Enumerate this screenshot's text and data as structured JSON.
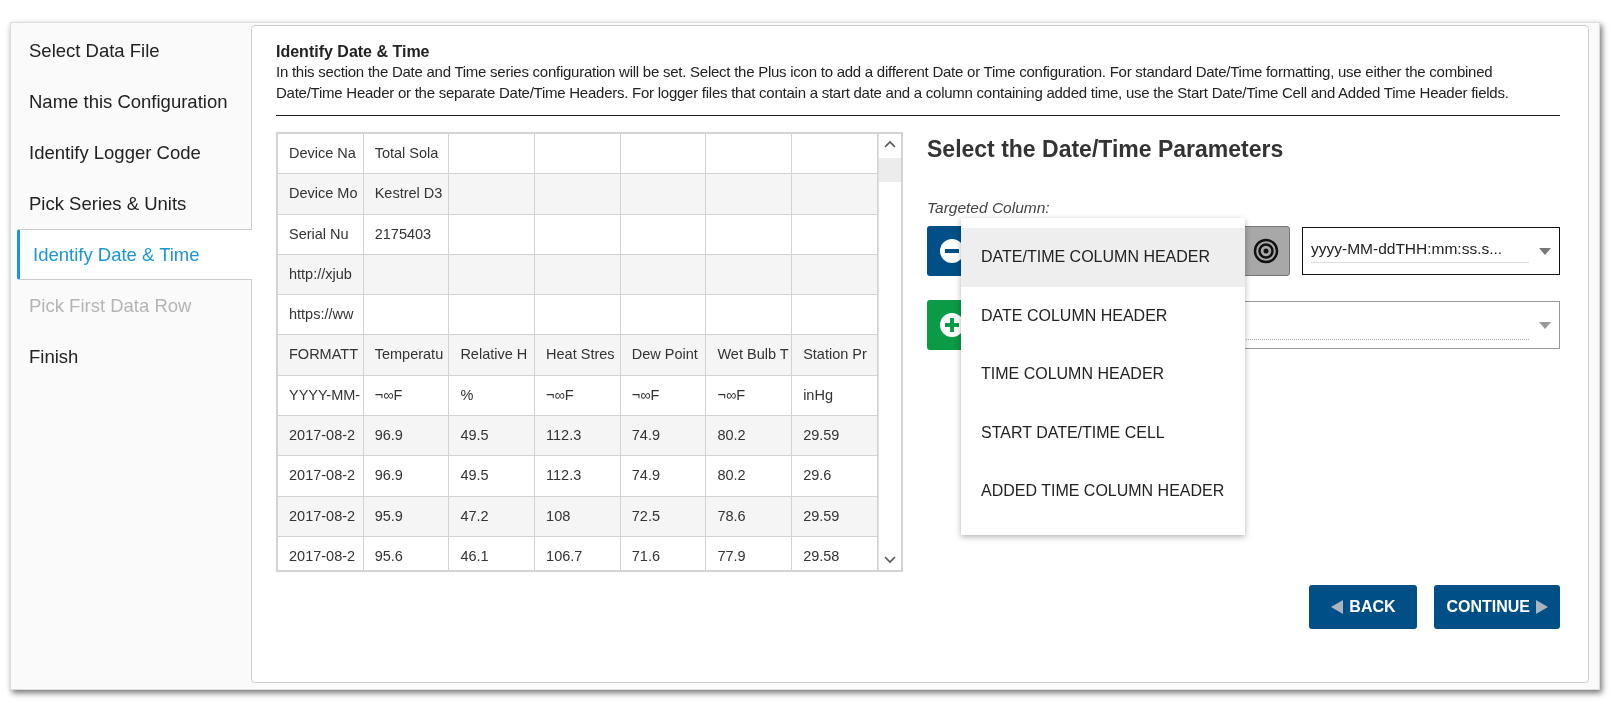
{
  "sidebar": {
    "items": [
      {
        "label": "Select Data File",
        "selected": false,
        "disabled": false
      },
      {
        "label": "Name this Configuration",
        "selected": false,
        "disabled": false
      },
      {
        "label": "Identify Logger Code",
        "selected": false,
        "disabled": false
      },
      {
        "label": "Pick Series & Units",
        "selected": false,
        "disabled": false
      },
      {
        "label": "Identify Date & Time",
        "selected": true,
        "disabled": false
      },
      {
        "label": "Pick First Data Row",
        "selected": false,
        "disabled": true
      },
      {
        "label": "Finish",
        "selected": false,
        "disabled": false
      }
    ]
  },
  "header": {
    "title": "Identify Date & Time",
    "description": "In this section the Date and Time series configuration will be set. Select the Plus icon to add a different Date or Time configuration. For standard Date/Time formatting, use either the combined Date/Time Header or the separate Date/Time Headers. For logger files that contain a start date and a column containing added time, use the Start Date/Time Cell and Added Time Header fields."
  },
  "table": {
    "rows": [
      {
        "cells": [
          "Device Na",
          "Total Sola"
        ]
      },
      {
        "cells": [
          "Device Mo",
          "Kestrel D3"
        ]
      },
      {
        "cells": [
          "Serial Nu",
          "2175403"
        ]
      },
      {
        "cells": [
          "http://xjub"
        ]
      },
      {
        "cells": [
          "https://ww"
        ]
      },
      {
        "cells": [
          "FORMATT",
          "Temperatu",
          "Relative H",
          "Heat Stres",
          "Dew Point",
          "Wet Bulb T",
          "Station Pr"
        ]
      },
      {
        "cells": [
          "YYYY-MM-",
          "¬∞F",
          "%",
          "¬∞F",
          "¬∞F",
          "¬∞F",
          "inHg"
        ]
      },
      {
        "cells": [
          "2017-08-2",
          "96.9",
          "49.5",
          "112.3",
          "74.9",
          "80.2",
          "29.59"
        ]
      },
      {
        "cells": [
          "2017-08-2",
          "96.9",
          "49.5",
          "112.3",
          "74.9",
          "80.2",
          "29.6"
        ]
      },
      {
        "cells": [
          "2017-08-2",
          "95.9",
          "47.2",
          "108",
          "72.5",
          "78.6",
          "29.59"
        ]
      },
      {
        "cells": [
          "2017-08-2",
          "95.6",
          "46.1",
          "106.7",
          "71.6",
          "77.9",
          "29.58"
        ]
      }
    ]
  },
  "parameters": {
    "title": "Select the Date/Time Parameters",
    "label": "Targeted Column:",
    "format_select": {
      "value": "yyyy-MM-ddTHH:mm:ss.s..."
    },
    "menu": [
      {
        "label": "DATE/TIME COLUMN HEADER",
        "selected": true
      },
      {
        "label": "DATE COLUMN HEADER",
        "selected": false
      },
      {
        "label": "TIME COLUMN HEADER",
        "selected": false
      },
      {
        "label": "START DATE/TIME CELL",
        "selected": false
      },
      {
        "label": "ADDED TIME COLUMN HEADER",
        "selected": false
      }
    ]
  },
  "buttons": [
    {
      "label": "BACK",
      "kind": "back"
    },
    {
      "label": "CONTINUE",
      "kind": "continue"
    }
  ]
}
